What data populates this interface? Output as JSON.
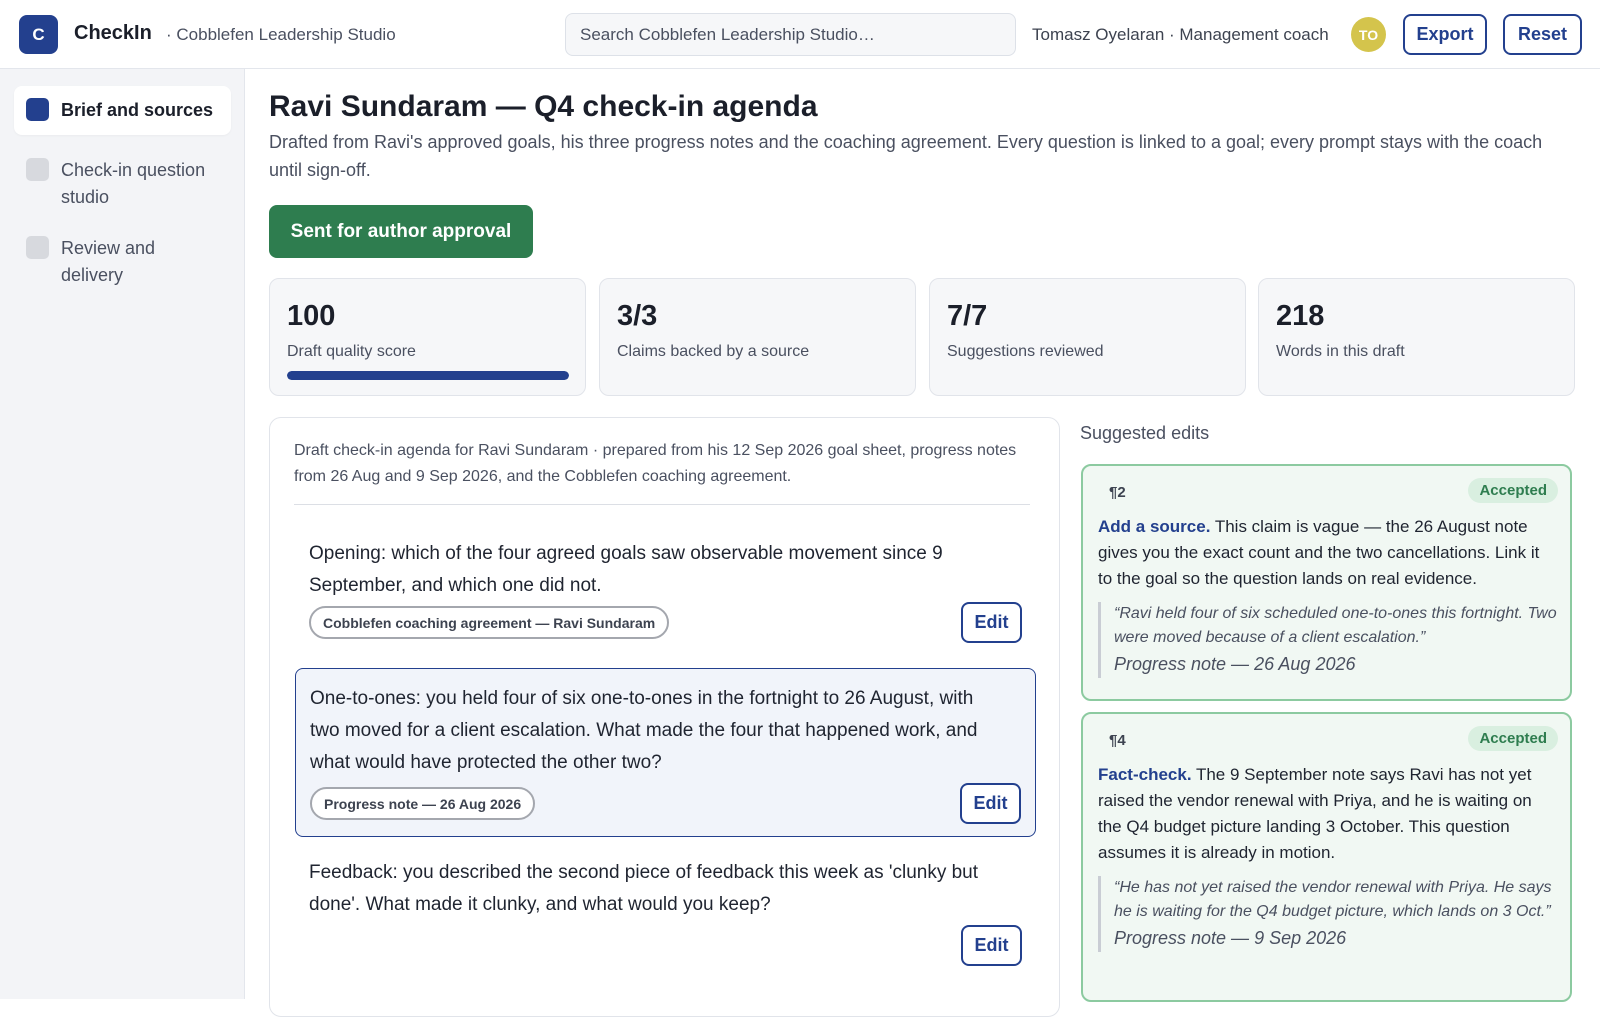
{
  "app": {
    "logo_letter": "C",
    "name": "CheckIn",
    "org": "· Cobblefen Leadership Studio"
  },
  "search": {
    "placeholder": "Search Cobblefen Leadership Studio…"
  },
  "user": {
    "label": "Tomasz Oyelaran · Management coach",
    "initials": "TO",
    "avatar_color": "#d4c44c"
  },
  "toolbar": {
    "export_label": "Export",
    "reset_label": "Reset"
  },
  "sidebar": {
    "items": [
      {
        "label": "Brief and sources",
        "active": true
      },
      {
        "label": "Check-in question studio",
        "active": false
      },
      {
        "label": "Review and delivery",
        "active": false
      }
    ]
  },
  "main": {
    "title": "Ravi Sundaram — Q4 check-in agenda",
    "description": "Drafted from Ravi's approved goals, his three progress notes and the coaching agreement. Every question is linked to a goal; every prompt stays with the coach until sign-off.",
    "status_label": "Sent for author approval",
    "status_color": "#2e7d4f"
  },
  "stats": [
    {
      "value": "100",
      "label": "Draft quality score",
      "progress": 1.0
    },
    {
      "value": "3/3",
      "label": "Claims backed by a source"
    },
    {
      "value": "7/7",
      "label": "Suggestions reviewed"
    },
    {
      "value": "218",
      "label": "Words in this draft"
    }
  ],
  "draft": {
    "header": "Draft check-in agenda for Ravi Sundaram · prepared from his 12 Sep 2026 goal sheet, progress notes from 26 Aug and 9 Sep 2026, and the Cobblefen coaching agreement.",
    "questions": [
      {
        "text": "Opening: which of the four agreed goals saw observable movement since 9 September, and which one did not.",
        "source": "Cobblefen coaching agreement — Ravi Sundaram",
        "edit_label": "Edit"
      },
      {
        "text": "One-to-ones: you held four of six one-to-ones in the fortnight to 26 August, with two moved for a client escalation. What made the four that happened work, and what would have protected the other two?",
        "source": "Progress note — 26 Aug 2026",
        "edit_label": "Edit"
      },
      {
        "text": "Feedback: you described the second piece of feedback this week as 'clunky but done'. What made it clunky, and what would you keep?",
        "edit_label": "Edit"
      }
    ]
  },
  "suggestions": {
    "title": "Suggested edits",
    "items": [
      {
        "para": "¶2",
        "status": "Accepted",
        "action": "Add a source.",
        "body": " This claim is vague — the 26 August note gives you the exact count and the two cancellations. Link it to the goal so the question lands on real evidence.",
        "quote": "“Ravi held four of six scheduled one-to-ones this fortnight. Two were moved because of a client escalation.”",
        "source": "Progress note — 26 Aug 2026"
      },
      {
        "para": "¶4",
        "status": "Accepted",
        "action": "Fact-check.",
        "body": " The 9 September note says Ravi has not yet raised the vendor renewal with Priya, and he is waiting on the Q4 budget picture landing 3 October. This question assumes it is already in motion.",
        "quote": "“He has not yet raised the vendor renewal with Priya. He says he is waiting for the Q4 budget picture, which lands on 3 Oct.”",
        "source": "Progress note — 9 Sep 2026"
      }
    ]
  }
}
